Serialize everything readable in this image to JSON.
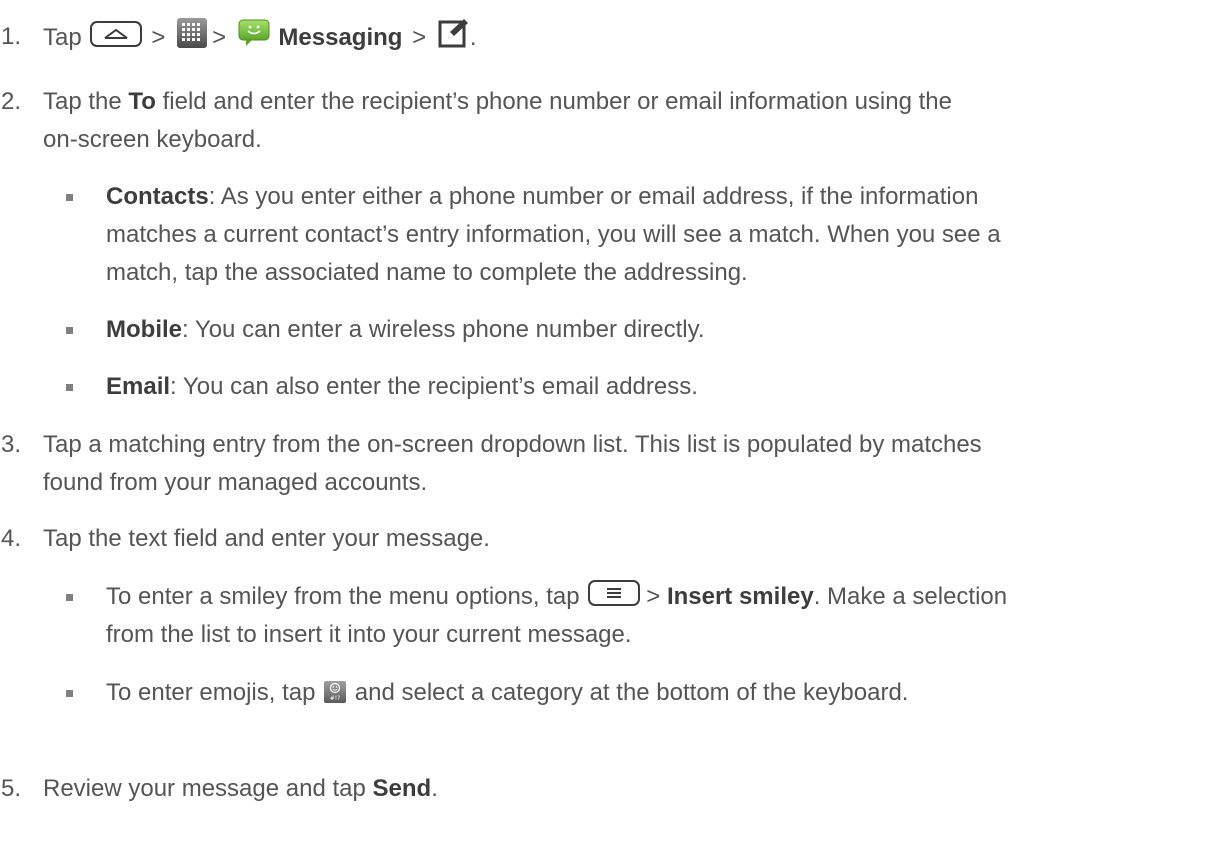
{
  "steps": [
    {
      "num": "1.",
      "tap": "Tap",
      "gt": ">",
      "messaging": "Messaging",
      "end": "."
    },
    {
      "num": "2.",
      "pre": "Tap the ",
      "bold": "To",
      "line1_post": " field and enter the recipient’s phone number or email information using the",
      "line2": "on-screen keyboard."
    },
    {
      "num": "3.",
      "line1": "Tap a matching entry from the on-screen dropdown list. This list is populated by matches",
      "line2": "found from your managed accounts."
    },
    {
      "num": "4.",
      "line1": "Tap the text field and enter your message."
    },
    {
      "num": "5.",
      "pre": "Review your message and tap ",
      "bold": "Send",
      "end": "."
    }
  ],
  "step2_bullets": [
    {
      "bold": "Contacts",
      "line1": ": As you enter either a phone number or email address, if the information",
      "line2": "matches a current contact’s entry information, you will see a match. When you see a",
      "line3": "match, tap the associated name to complete the addressing."
    },
    {
      "bold": "Mobile",
      "line1": ": You can enter a wireless phone number directly."
    },
    {
      "bold": "Email",
      "line1": ": You can also enter the recipient’s email address."
    }
  ],
  "step4_bullets": [
    {
      "pre": "To enter a smiley from the menu options, tap",
      "gt": ">",
      "bold": "Insert smiley",
      "post": ". Make a selection",
      "line2": "from the list to insert it into your current message."
    },
    {
      "pre": "To enter emojis, tap",
      "post": " and select a category at the bottom of the keyboard."
    }
  ],
  "icons": {
    "home": "home-key-icon",
    "apps": "apps-grid-icon",
    "messaging": "messaging-app-icon",
    "compose": "compose-icon",
    "menu": "menu-key-icon",
    "emoji": "emoji-keyboard-icon"
  },
  "colors": {
    "body_text": "#555555",
    "bold_text": "#3d3d3d",
    "messaging_green": "#7ac943"
  }
}
